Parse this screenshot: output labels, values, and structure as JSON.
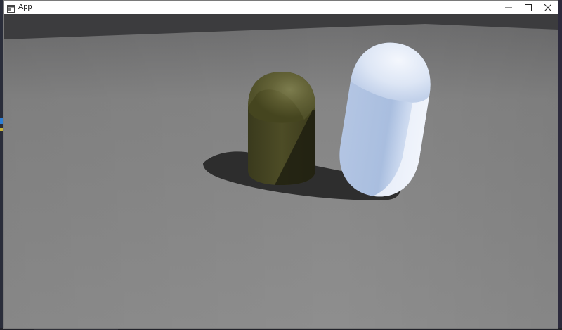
{
  "window": {
    "title": "App",
    "minimize_glyph": "—",
    "maximize_glyph": "☐",
    "close_glyph": "✕"
  },
  "icons": {
    "app_icon": "app-window-icon",
    "minimize": "minimize-icon",
    "maximize": "maximize-icon",
    "close": "close-icon"
  },
  "scene": {
    "background_color": "#3c3c3e",
    "floor_color": "#8c8c8c",
    "floor_far_color": "#6f6f70",
    "shadow_color": "#262626",
    "olive_capsule_color": "#5b5a2e",
    "olive_capsule_dark": "#2c2c17",
    "white_capsule_color": "#d9e4f5",
    "white_capsule_shade": "#a9bedf"
  }
}
